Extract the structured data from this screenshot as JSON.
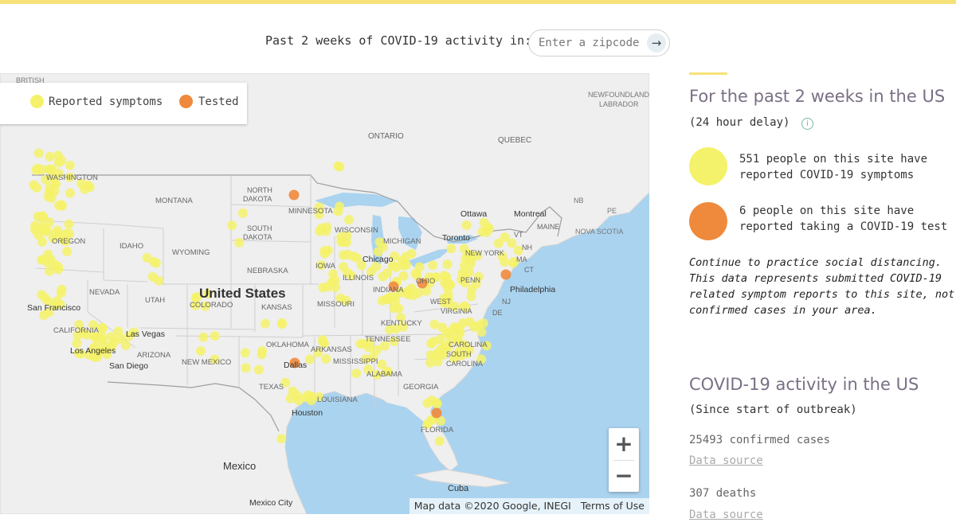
{
  "header": {
    "label": "Past 2 weeks of COVID-19 activity in:",
    "zip_placeholder": "Enter a zipcode",
    "go_icon": "→"
  },
  "legend": {
    "symptoms_label": "Reported symptoms",
    "tested_label": "Tested",
    "symptoms_color": "#f4f26a",
    "tested_color": "#ef8a3c"
  },
  "map": {
    "labels": {
      "british": "BRITISH",
      "newfoundland": "NEWFOUNDLAND",
      "labrador": "LABRADOR",
      "ontario": "ONTARIO",
      "quebec": "QUEBEC",
      "nb": "NB",
      "pe": "PE",
      "nova_scotia": "NOVA SCOTIA",
      "ottawa": "Ottawa",
      "montreal": "Montreal",
      "toronto": "Toronto",
      "maine": "MAINE",
      "vt": "VT",
      "nh": "NH",
      "ma": "MA",
      "new_york": "NEW YORK",
      "ct": "CT",
      "penn": "PENN",
      "philadelphia": "Philadelphia",
      "nj": "NJ",
      "de": "DE",
      "washington": "WASHINGTON",
      "oregon": "OREGON",
      "idaho": "IDAHO",
      "montana": "MONTANA",
      "wyoming": "WYOMING",
      "north_dakota_1": "NORTH",
      "north_dakota_2": "DAKOTA",
      "south_dakota_1": "SOUTH",
      "south_dakota_2": "DAKOTA",
      "minnesota": "MINNESOTA",
      "wisconsin": "WISCONSIN",
      "michigan": "MICHIGAN",
      "iowa": "IOWA",
      "nebraska": "NEBRASKA",
      "illinois": "ILLINOIS",
      "chicago": "Chicago",
      "indiana": "INDIANA",
      "ohio": "OHIO",
      "nevada": "NEVADA",
      "utah": "UTAH",
      "colorado": "COLORADO",
      "kansas": "KANSAS",
      "missouri": "MISSOURI",
      "united_states": "United States",
      "west": "WEST",
      "virginia": "VIRGINIA",
      "kentucky": "KENTUCKY",
      "tennessee": "TENNESSEE",
      "north_carolina": "CAROLINA",
      "south_carolina_1": "SOUTH",
      "south_carolina_2": "CAROLINA",
      "california": "CALIFORNIA",
      "san_francisco": "San Francisco",
      "las_vegas": "Las Vegas",
      "los_angeles": "Los Angeles",
      "san_diego": "San Diego",
      "arizona": "ARIZONA",
      "new_mexico": "NEW MEXICO",
      "oklahoma": "OKLAHOMA",
      "arkansas": "ARKANSAS",
      "mississippi": "MISSISSIPPI",
      "alabama": "ALABAMA",
      "georgia": "GEORGIA",
      "texas": "TEXAS",
      "dallas": "Dallas",
      "louisiana": "LOUISIANA",
      "houston": "Houston",
      "florida": "FLORIDA",
      "mexico": "Mexico",
      "mexico_city": "Mexico City",
      "cuba": "Cuba"
    },
    "zoom_in": "+",
    "zoom_out": "−",
    "attribution": "Map data ©2020 Google, INEGI",
    "terms": "Terms of Use"
  },
  "sidebar": {
    "recent_title": "For the past 2 weeks in the US",
    "recent_delay": "(24 hour delay)",
    "info_icon": "i",
    "symptoms_stat": "551 people on this site have reported COVID-19 symptoms",
    "tested_stat": "6 people on this site have reported taking a COVID-19 test",
    "note": "Continue to practice social distancing. This data represents submitted COVID-19 related symptom reports to this site, not confirmed cases in your area.",
    "total_title": "COVID-19 activity in the US",
    "total_since": "(Since start of outbreak)",
    "confirmed": "25493 confirmed cases",
    "source_1": "Data source",
    "deaths": "307 deaths",
    "source_2": "Data source"
  }
}
